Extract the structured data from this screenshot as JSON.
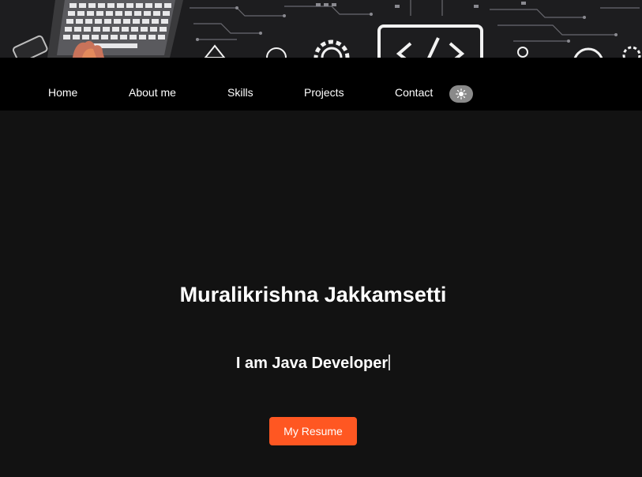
{
  "nav": {
    "items": [
      {
        "label": "Home"
      },
      {
        "label": "About me"
      },
      {
        "label": "Skills"
      },
      {
        "label": "Projects"
      },
      {
        "label": "Contact"
      }
    ],
    "theme_toggle_icon": "sun-icon"
  },
  "hero": {
    "name": "Muralikrishna Jakkamsetti",
    "role": "I am Java Developer",
    "resume_button": "My Resume"
  },
  "colors": {
    "page_background": "#121212",
    "nav_background": "#000000",
    "accent": "#ff5722",
    "text": "#ffffff",
    "toggle": "#8a8a8a"
  }
}
